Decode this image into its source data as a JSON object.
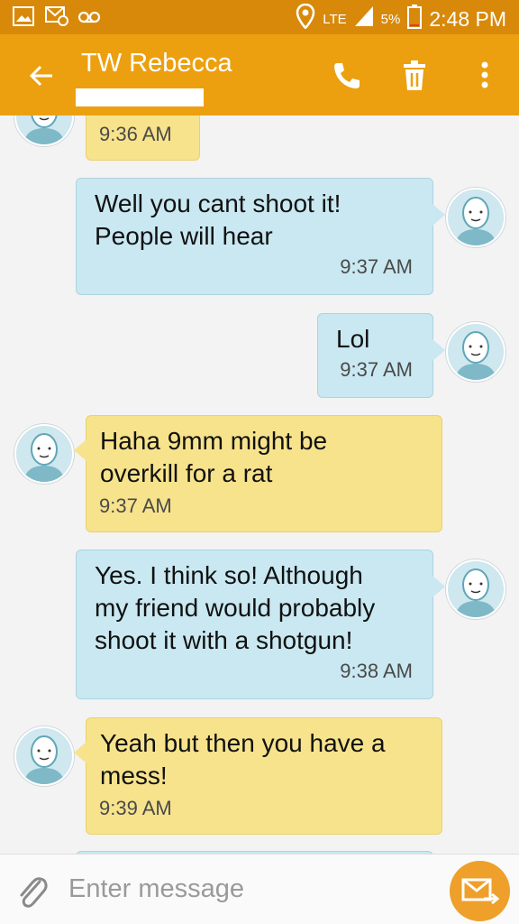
{
  "status_bar": {
    "signal_label": "LTE",
    "battery": "5%",
    "time": "2:48 PM",
    "left_icons": [
      "gallery-icon",
      "mms-icon",
      "voicemail-icon"
    ],
    "right_icons": [
      "location-icon",
      "signal-icon",
      "battery-icon"
    ]
  },
  "app_bar": {
    "title": "TW Rebecca",
    "color": "#eca00f",
    "icons": [
      "back-arrow-icon",
      "phone-icon",
      "trash-icon",
      "more-vert-icon"
    ]
  },
  "messages": [
    {
      "direction": "incoming",
      "text": "",
      "time": "9:36 AM"
    },
    {
      "direction": "outgoing",
      "text": "Well you cant shoot it!\nPeople will hear",
      "time": "9:37 AM"
    },
    {
      "direction": "outgoing",
      "text": "Lol",
      "time": "9:37 AM"
    },
    {
      "direction": "incoming",
      "text": "Haha 9mm might be\noverkill for a rat",
      "time": "9:37 AM"
    },
    {
      "direction": "outgoing",
      "text": "Yes. I think so! Although\nmy friend would probably\nshoot it with a shotgun!",
      "time": "9:38 AM"
    },
    {
      "direction": "incoming",
      "text": "Yeah but then you have a\nmess!",
      "time": "9:39 AM"
    }
  ],
  "composer": {
    "placeholder": "Enter message",
    "icons": [
      "paperclip-icon",
      "send-message-icon"
    ]
  },
  "colors": {
    "incoming_bubble": "#f7e38c",
    "outgoing_bubble": "#c9e8f1",
    "accent": "#eea02a"
  }
}
